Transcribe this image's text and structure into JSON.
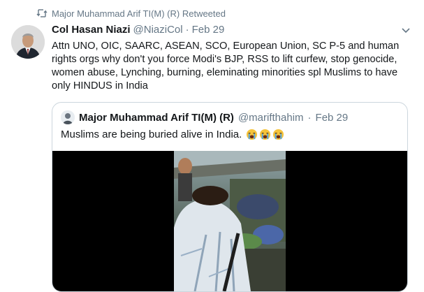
{
  "retweet_banner": {
    "icon": "retweet-icon",
    "text": "Major Muhammad Arif TI(M) (R) Retweeted"
  },
  "tweet": {
    "display_name": "Col Hasan Niazi",
    "handle": "@NiaziCol",
    "separator": "·",
    "date": "Feb 29",
    "text": "Attn UNO, OIC, SAARC, ASEAN, SCO, European Union, SC P-5 and human rights orgs why don't you force Modi's BJP, RSS to lift curfew, stop genocide, women abuse, Lynching, burning, eleminating minorities spl Muslims to have only HINDUS in India"
  },
  "quoted_tweet": {
    "display_name": "Major Muhammad Arif TI(M) (R)",
    "handle": "@marifthahim",
    "separator": "·",
    "date": "Feb 29",
    "text": "Muslims are being buried alive in India.",
    "emojis": [
      "loudly-crying-face",
      "loudly-crying-face",
      "loudly-crying-face"
    ]
  },
  "colors": {
    "text_primary": "#14171a",
    "text_secondary": "#657786",
    "border": "#ccd6dd",
    "media_background": "#000000"
  }
}
